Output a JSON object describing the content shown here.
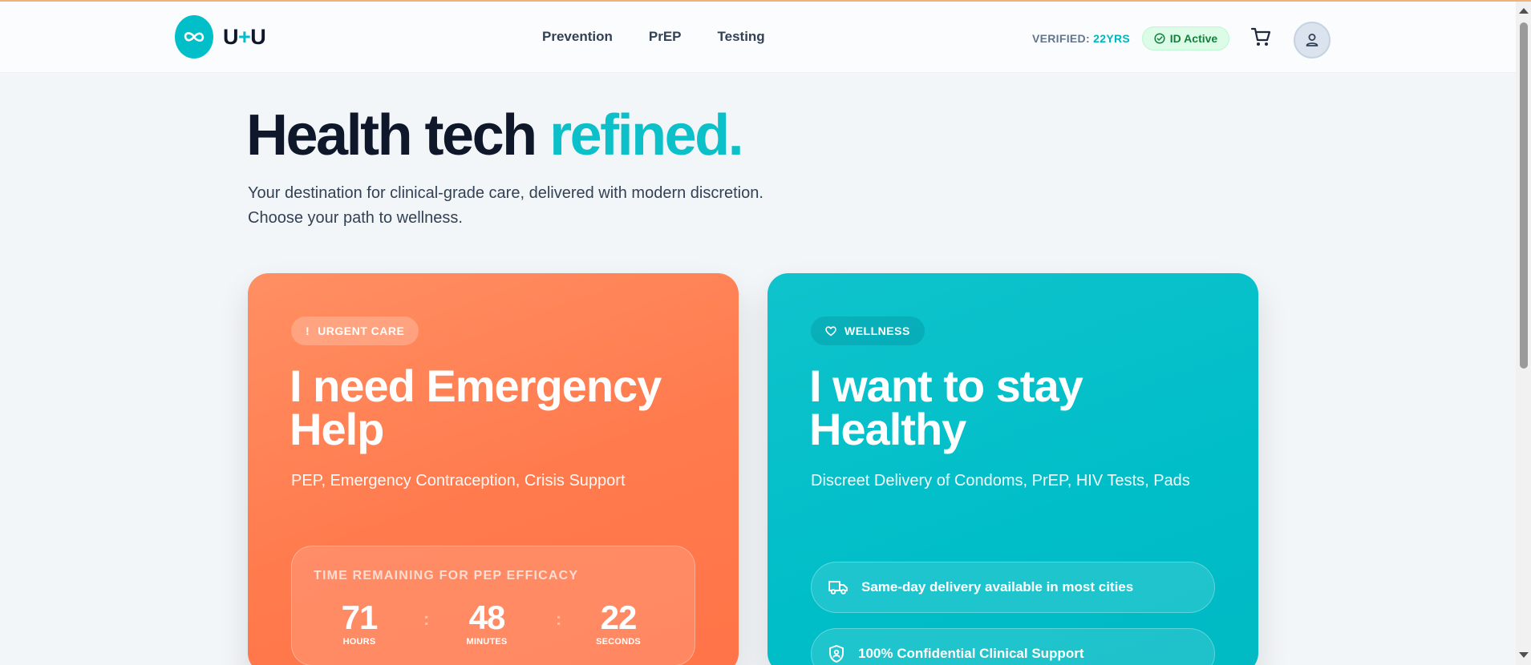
{
  "brand": {
    "name_part1": "U",
    "name_plus": "+",
    "name_part2": "U",
    "logo_icon": "infinity-icon",
    "accent": "#00bfc8"
  },
  "nav": {
    "items": [
      {
        "label": "Prevention"
      },
      {
        "label": "PrEP"
      },
      {
        "label": "Testing"
      }
    ]
  },
  "header": {
    "verified_label": "VERIFIED:",
    "verified_age": "22YRS",
    "id_badge": "ID Active",
    "cart_icon": "cart-icon",
    "avatar_icon": "user-icon"
  },
  "hero": {
    "title_main": "Health tech ",
    "title_accent": "refined.",
    "subtitle_line1": "Your destination for clinical-grade care, delivered with modern discretion.",
    "subtitle_line2": "Choose your path to wellness."
  },
  "cards": {
    "emergency": {
      "chip": "URGENT CARE",
      "chip_icon": "exclamation-icon",
      "title": "I need Emergency Help",
      "subtitle": "PEP, Emergency Contraception, Crisis Support",
      "color": "#ff7a4d",
      "timer": {
        "label": "TIME REMAINING FOR PEP EFFICACY",
        "hours": "71",
        "hours_label": "HOURS",
        "minutes": "48",
        "minutes_label": "MINUTES",
        "seconds": "22",
        "seconds_label": "SECONDS",
        "separator": ":"
      }
    },
    "wellness": {
      "chip": "WELLNESS",
      "chip_icon": "heart-icon",
      "title": "I want to stay Healthy",
      "subtitle": "Discreet Delivery of Condoms, PrEP, HIV Tests, Pads",
      "color": "#00bec8",
      "features": [
        {
          "icon": "truck-icon",
          "label": "Same-day delivery available in most cities"
        },
        {
          "icon": "shield-icon",
          "label": "100% Confidential Clinical Support"
        }
      ]
    }
  }
}
